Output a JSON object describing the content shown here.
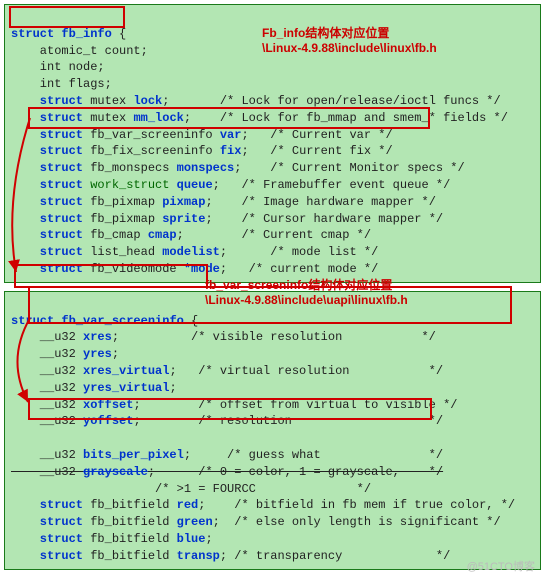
{
  "block1": {
    "l1a": "struct",
    "l1b": " fb_info",
    "l1c": " {",
    "l2": "    atomic_t count;",
    "l3": "    int node;",
    "l4": "    int flags;",
    "l5a": "    struct",
    "l5b": " mutex ",
    "l5c": "lock",
    "l5d": ";       /* Lock for open/release/ioctl funcs */",
    "l6a": "    struct",
    "l6b": " mutex ",
    "l6c": "mm_lock",
    "l6d": ";    /* Lock for fb_mmap and smem_* fields */",
    "l7a": "    struct",
    "l7b": " fb_var_screeninfo ",
    "l7c": "var",
    "l7d": ";   /* Current var */",
    "l8a": "    struct",
    "l8b": " fb_fix_screeninfo ",
    "l8c": "fix",
    "l8d": ";   /* Current fix */",
    "l9a": "    struct",
    "l9b": " fb_monspecs ",
    "l9c": "monspecs",
    "l9d": ";    /* Current Monitor specs */",
    "l10a": "    struct",
    "l10b": " work_struct ",
    "l10c": "queue",
    "l10d": ";   /* Framebuffer event queue */",
    "l11a": "    struct",
    "l11b": " fb_pixmap ",
    "l11c": "pixmap",
    "l11d": ";    /* Image hardware mapper */",
    "l12a": "    struct",
    "l12b": " fb_pixmap ",
    "l12c": "sprite",
    "l12d": ";    /* Cursor hardware mapper */",
    "l13a": "    struct",
    "l13b": " fb_cmap ",
    "l13c": "cmap",
    "l13d": ";        /* Current cmap */",
    "l14a": "    struct",
    "l14b": " list_head ",
    "l14c": "modelist",
    "l14d": ";      /* mode list */",
    "l15a": "    struct",
    "l15b": " fb_videomode ",
    "l15c": "*mode",
    "l15d": ";   /* current mode */"
  },
  "note1": {
    "line1": "Fb_info结构体对应位置",
    "line2": "\\Linux-4.9.88\\include\\linux\\fb.h"
  },
  "block2": {
    "l1a": "struct",
    "l1b": " fb_var_screeninfo",
    "l1c": " {",
    "l2a": "    __u32 ",
    "l2b": "xres",
    "l2c": ";          /* visible resolution           */",
    "l3a": "    __u32 ",
    "l3b": "yres",
    "l3c": ";",
    "l4a": "    __u32 ",
    "l4b": "xres_virtual",
    "l4c": ";   /* virtual resolution           */",
    "l5a": "    __u32 ",
    "l5b": "yres_virtual",
    "l5c": ";",
    "l6a": "    __u32 ",
    "l6b": "xoffset",
    "l6c": ";        /* offset from virtual to visible */",
    "l7a": "    __u32 ",
    "l7b": "yoffset",
    "l7c": ";        /* resolution                   */",
    "l8": "",
    "l9a": "    __u32 ",
    "l9b": "bits_per_pixel",
    "l9c": ";     /* guess what               */",
    "l10a": "    __u32 ",
    "l10b": "grayscale",
    "l10c": ";      /* 0 = color, 1 = grayscale,    */",
    "l11": "                    /* >1 = FOURCC              */",
    "l12a": "    struct",
    "l12b": " fb_bitfield ",
    "l12c": "red",
    "l12d": ";    /* bitfield in fb mem if true color, */",
    "l13a": "    struct",
    "l13b": " fb_bitfield ",
    "l13c": "green",
    "l13d": ";  /* else only length is significant */",
    "l14a": "    struct",
    "l14b": " fb_bitfield ",
    "l14c": "blue",
    "l14d": ";",
    "l15a": "    struct",
    "l15b": " fb_bitfield ",
    "l15c": "transp",
    "l15d": "; /* transparency             */"
  },
  "note2": {
    "line1": "fb_var_screeninfo结构体对应位置",
    "line2": "\\Linux-4.9.88\\include\\uapi\\linux\\fb.h"
  },
  "watermark": "@51CTO博客"
}
